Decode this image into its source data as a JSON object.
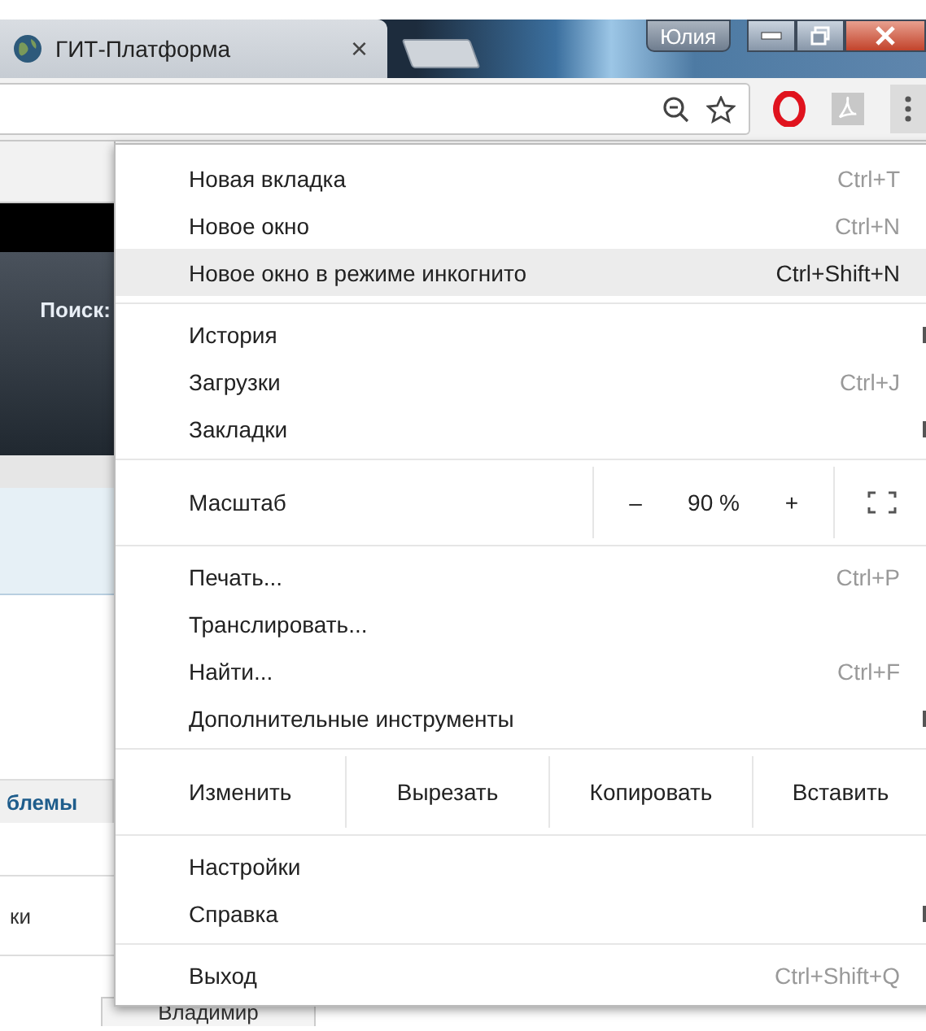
{
  "tab": {
    "title": "ГИТ-Платформа",
    "close": "×"
  },
  "window": {
    "user": "Юлия"
  },
  "page": {
    "search_label": "Поиск:",
    "column_header": "блемы",
    "cell": "ки",
    "cell_2": "Владимир"
  },
  "menu": {
    "items": [
      {
        "kind": "item",
        "label": "Новая вкладка",
        "shortcut": "Ctrl+T",
        "highlighted": false,
        "submenu": false
      },
      {
        "kind": "item",
        "label": "Новое окно",
        "shortcut": "Ctrl+N",
        "highlighted": false,
        "submenu": false
      },
      {
        "kind": "item",
        "label": "Новое окно в режиме инкогнито",
        "shortcut": "Ctrl+Shift+N",
        "highlighted": true,
        "submenu": false
      },
      {
        "kind": "separator"
      },
      {
        "kind": "item",
        "label": "История",
        "highlighted": false,
        "submenu": true
      },
      {
        "kind": "item",
        "label": "Загрузки",
        "shortcut": "Ctrl+J",
        "highlighted": false,
        "submenu": false
      },
      {
        "kind": "item",
        "label": "Закладки",
        "highlighted": false,
        "submenu": true
      },
      {
        "kind": "separator"
      },
      {
        "kind": "zoom",
        "label": "Масштаб",
        "minus": "–",
        "value": "90 %",
        "plus": "+"
      },
      {
        "kind": "separator"
      },
      {
        "kind": "item",
        "label": "Печать...",
        "shortcut": "Ctrl+P",
        "highlighted": false,
        "submenu": false
      },
      {
        "kind": "item",
        "label": "Транслировать...",
        "highlighted": false,
        "submenu": false
      },
      {
        "kind": "item",
        "label": "Найти...",
        "shortcut": "Ctrl+F",
        "highlighted": false,
        "submenu": false
      },
      {
        "kind": "item",
        "label": "Дополнительные инструменты",
        "highlighted": false,
        "submenu": true
      },
      {
        "kind": "separator"
      },
      {
        "kind": "edit",
        "label": "Изменить",
        "buttons": [
          "Вырезать",
          "Копировать",
          "Вставить"
        ]
      },
      {
        "kind": "separator"
      },
      {
        "kind": "item",
        "label": "Настройки",
        "highlighted": false,
        "submenu": false
      },
      {
        "kind": "item",
        "label": "Справка",
        "highlighted": false,
        "submenu": true
      },
      {
        "kind": "separator"
      },
      {
        "kind": "item",
        "label": "Выход",
        "shortcut": "Ctrl+Shift+Q",
        "highlighted": false,
        "submenu": false
      }
    ]
  }
}
